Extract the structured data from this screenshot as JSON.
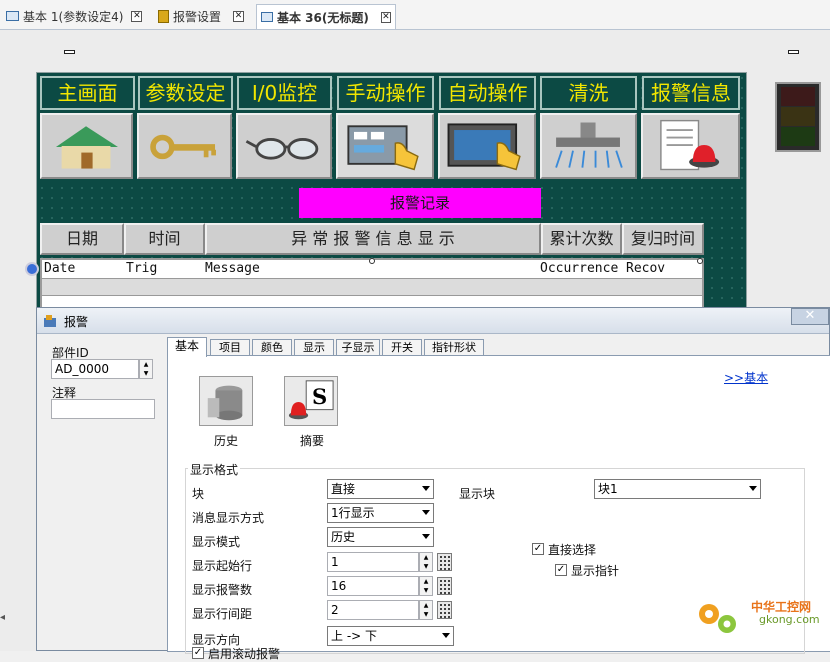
{
  "doc_tabs": [
    {
      "label": "基本 1(参数设定4)",
      "active": false
    },
    {
      "label": "报警设置",
      "active": false
    },
    {
      "label": "基本 36(无标题)",
      "active": true
    }
  ],
  "hmi": {
    "nav": [
      "主画面",
      "参数设定",
      "I/0监控",
      "手动操作",
      "自动操作",
      "清洗",
      "报警信息"
    ],
    "nav_icons": [
      "house-icon",
      "key-icon",
      "glasses-icon",
      "hand-panel-icon",
      "touch-screen-icon",
      "spray-icon",
      "report-alarm-icon"
    ],
    "alarm_title": "报警记录",
    "headers": [
      "日期",
      "时间",
      "异 常 报 警 信 息 显 示",
      "累计次数",
      "复归时间"
    ],
    "table_cols": [
      "Date",
      "Trig",
      "Message",
      "Occurrence",
      "Recov"
    ],
    "lamp_colors": [
      "#3d1a1a",
      "#3a3314",
      "#1d3a14"
    ]
  },
  "dialog": {
    "title": "报警",
    "part_id_label": "部件ID",
    "part_id_value": "AD_0000",
    "note_label": "注释",
    "tabs": [
      "基本",
      "项目",
      "颜色",
      "显示",
      "子显示",
      "开关",
      "指针形状"
    ],
    "link": ">>基本",
    "icon_history": "历史",
    "icon_summary": "摘要",
    "group_title": "显示格式",
    "rows": {
      "block_label": "块",
      "block_value": "直接",
      "display_block_label": "显示块",
      "display_block_value": "块1",
      "msg_mode_label": "消息显示方式",
      "msg_mode_value": "1行显示",
      "display_mode_label": "显示模式",
      "display_mode_value": "历史",
      "start_row_label": "显示起始行",
      "start_row_value": "1",
      "alarm_count_label": "显示报警数",
      "alarm_count_value": "16",
      "row_gap_label": "显示行间距",
      "row_gap_value": "2",
      "direction_label": "显示方向",
      "direction_value": "上 -> 下",
      "direct_select_label": "直接选择",
      "show_pointer_label": "显示指针",
      "scroll_label": "启用滚动报警"
    }
  },
  "watermark": {
    "text": "中华工控网",
    "sub": "gkong.com"
  }
}
